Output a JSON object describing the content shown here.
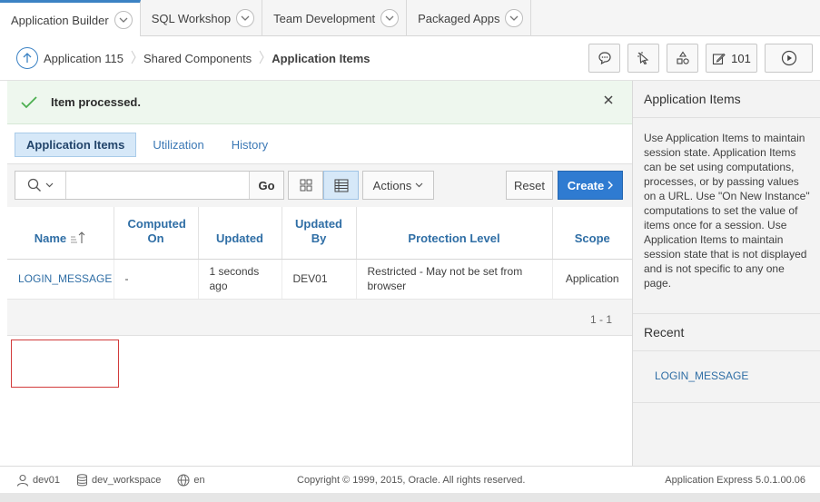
{
  "top_tabs": [
    {
      "label": "Application Builder",
      "active": true
    },
    {
      "label": "SQL Workshop",
      "active": false
    },
    {
      "label": "Team Development",
      "active": false
    },
    {
      "label": "Packaged Apps",
      "active": false
    }
  ],
  "breadcrumb": {
    "app": "Application 115",
    "shared": "Shared Components",
    "current": "Application Items"
  },
  "toolbar_buttons": {
    "count_label": "101"
  },
  "alert": {
    "message": "Item processed."
  },
  "sub_tabs": [
    {
      "label": "Application Items",
      "active": true
    },
    {
      "label": "Utilization",
      "active": false
    },
    {
      "label": "History",
      "active": false
    }
  ],
  "report_toolbar": {
    "search_value": "",
    "go_label": "Go",
    "actions_label": "Actions",
    "reset_label": "Reset",
    "create_label": "Create"
  },
  "table": {
    "columns": [
      "Name",
      "Computed On",
      "Updated",
      "Updated By",
      "Protection Level",
      "Scope"
    ],
    "rows": [
      {
        "name": "LOGIN_MESSAGE",
        "computed_on": "-",
        "updated": "1 seconds ago",
        "updated_by": "DEV01",
        "protection_level": "Restricted - May not be set from browser",
        "scope": "Application"
      }
    ],
    "pagination": "1 - 1"
  },
  "right_panel": {
    "title": "Application Items",
    "description": "Use Application Items to maintain session state. Application Items can be set using computations, processes, or by passing values on a URL. Use \"On New Instance\" computations to set the value of items once for a session. Use Application Items to maintain session state that is not displayed and is not specific to any one page.",
    "recent_title": "Recent",
    "recent_items": [
      "LOGIN_MESSAGE"
    ]
  },
  "footer": {
    "user": "dev01",
    "workspace": "dev_workspace",
    "language": "en",
    "copyright": "Copyright © 1999, 2015, Oracle. All rights reserved.",
    "version": "Application Express 5.0.1.00.06"
  },
  "colors": {
    "accent": "#2f7bd1",
    "link": "#2f6ea5",
    "success_bg": "#eef7ee",
    "success_icon": "#4caf50",
    "highlight": "#d23b3b"
  }
}
